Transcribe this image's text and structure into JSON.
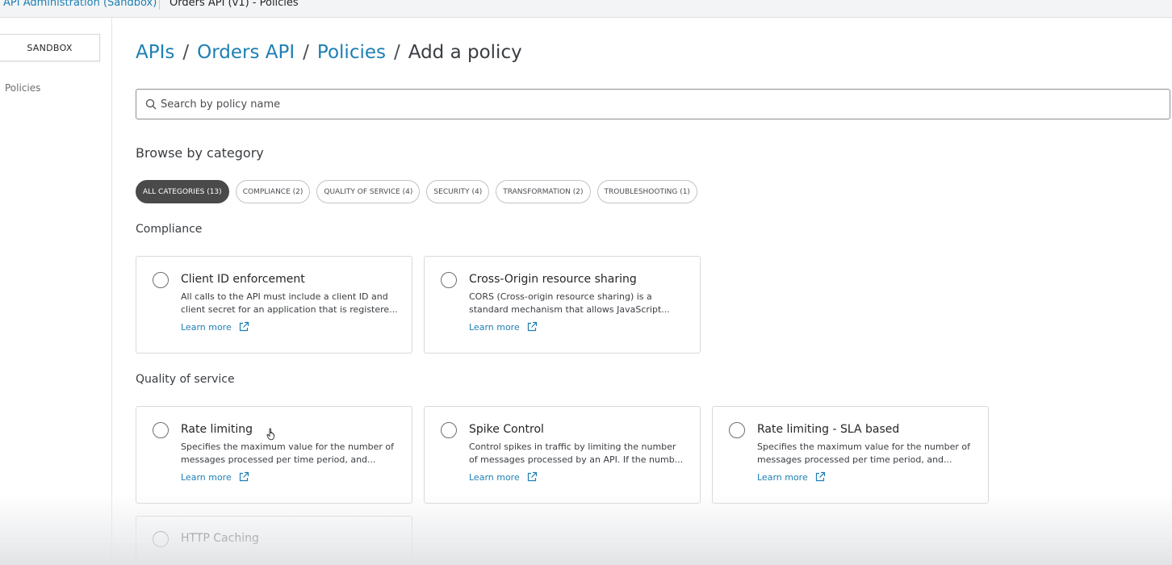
{
  "topbar": {
    "root_crumb": "API Administration (Sandbox)",
    "page_crumb": "Orders API (v1) - Policies"
  },
  "sidebar": {
    "environment_label": "SANDBOX",
    "items": [
      {
        "label": "Policies"
      }
    ]
  },
  "breadcrumb": {
    "apis": "APIs",
    "orders_api": "Orders API",
    "policies": "Policies",
    "current": "Add a policy",
    "separator": "/"
  },
  "search": {
    "placeholder": "Search by policy name",
    "icon": "search-icon"
  },
  "browse": {
    "title": "Browse by category",
    "selected": "ALL CATEGORIES (13)",
    "categories": [
      "ALL CATEGORIES (13)",
      "COMPLIANCE (2)",
      "QUALITY OF SERVICE (4)",
      "SECURITY (4)",
      "TRANSFORMATION (2)",
      "TROUBLESHOOTING (1)"
    ]
  },
  "sections": [
    {
      "title": "Compliance",
      "policies": [
        {
          "name": "Client ID enforcement",
          "description_lines": [
            "All calls to the API must include a client ID and",
            "client secret for an application that is registere..."
          ],
          "learn_more": "Learn more"
        },
        {
          "name": "Cross-Origin resource sharing",
          "description_lines": [
            "CORS (Cross-origin resource sharing) is a",
            "standard mechanism that allows JavaScript..."
          ],
          "learn_more": "Learn more"
        }
      ]
    },
    {
      "title": "Quality of service",
      "policies": [
        {
          "name": "Rate limiting",
          "description_lines": [
            "Specifies the maximum value for the number of",
            "messages processed per time period, and..."
          ],
          "learn_more": "Learn more"
        },
        {
          "name": "Spike Control",
          "description_lines": [
            "Control spikes in traffic by limiting the number",
            "of messages processed by an API. If the numb..."
          ],
          "learn_more": "Learn more"
        },
        {
          "name": "Rate limiting - SLA based",
          "description_lines": [
            "Specifies the maximum value for the number of",
            "messages processed per time period, and..."
          ],
          "learn_more": "Learn more"
        },
        {
          "name": "HTTP Caching",
          "description_lines": [],
          "learn_more": ""
        }
      ]
    }
  ],
  "colors": {
    "link": "#1d7fb3",
    "active_chip": "#4a4a4a",
    "text": "#262626",
    "border": "#d7d9dc"
  }
}
